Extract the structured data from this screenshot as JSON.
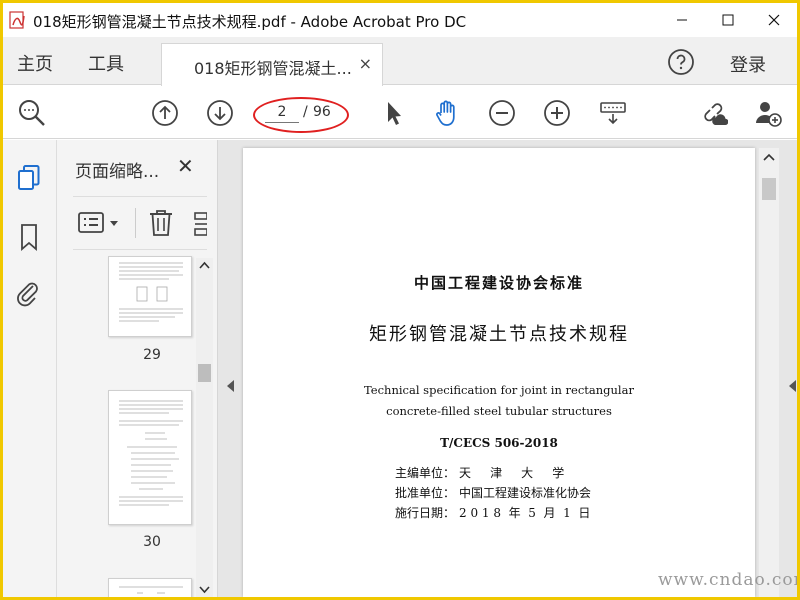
{
  "window": {
    "title": "018矩形钢管混凝土节点技术规程.pdf - Adobe Acrobat Pro DC"
  },
  "menubar": {
    "home": "主页",
    "tools": "工具",
    "tab_label": "018矩形钢管混凝土...",
    "tab_close": "×",
    "login": "登录"
  },
  "toolbar": {
    "page_current": "2",
    "page_separator": "/",
    "page_total": "96"
  },
  "thumbnails": {
    "panel_title": "页面缩略...",
    "close": "✕",
    "items": [
      {
        "label": "29"
      },
      {
        "label": "30"
      }
    ]
  },
  "document": {
    "standard_type": "中国工程建设协会标准",
    "title_cn": "矩形钢管混凝土节点技术规程",
    "title_en_line1": "Technical specification for joint in rectangular",
    "title_en_line2": "concrete-filled steel tubular structures",
    "code": "T/CECS 506-2018",
    "meta": [
      {
        "label": "主编单位：",
        "value": "天     津     大     学"
      },
      {
        "label": "批准单位：",
        "value": "中国工程建设标准化协会"
      },
      {
        "label": "施行日期：",
        "value": "2 0 1 8  年  5  月  1  日"
      }
    ]
  },
  "watermark": "www.cndao.com",
  "colors": {
    "accent_blue": "#1f6fcf",
    "frame_yellow": "#f0c800",
    "annotation_red": "#e02020"
  },
  "icons": {
    "search": "search-icon",
    "page_up": "arrow-up-icon",
    "page_down": "arrow-down-icon",
    "select": "cursor-icon",
    "hand": "hand-icon",
    "zoom_out": "zoom-out-icon",
    "zoom_in": "zoom-in-icon",
    "keyboard": "keyboard-icon",
    "share": "share-link-icon",
    "add_user": "add-user-icon"
  }
}
